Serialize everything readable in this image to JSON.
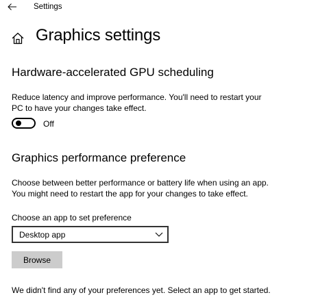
{
  "window": {
    "title": "Settings",
    "back_icon": "arrow-left-icon"
  },
  "header": {
    "home_icon": "home-icon",
    "title": "Graphics settings"
  },
  "gpu_scheduling": {
    "heading": "Hardware-accelerated GPU scheduling",
    "description_line1": "Reduce latency and improve performance. You'll need to restart your",
    "description_line2": "PC to have your changes take effect.",
    "toggle_state": "Off",
    "toggle_on": false
  },
  "performance_preference": {
    "heading": "Graphics performance preference",
    "description_line1": "Choose between better performance or battery life when using an app.",
    "description_line2": "You might need to restart the app for your changes to take effect.",
    "app_select_label": "Choose an app to set preference",
    "app_select_value": "Desktop app",
    "browse_label": "Browse",
    "empty_message": "We didn't find any of your preferences yet. Select an app to get started."
  }
}
